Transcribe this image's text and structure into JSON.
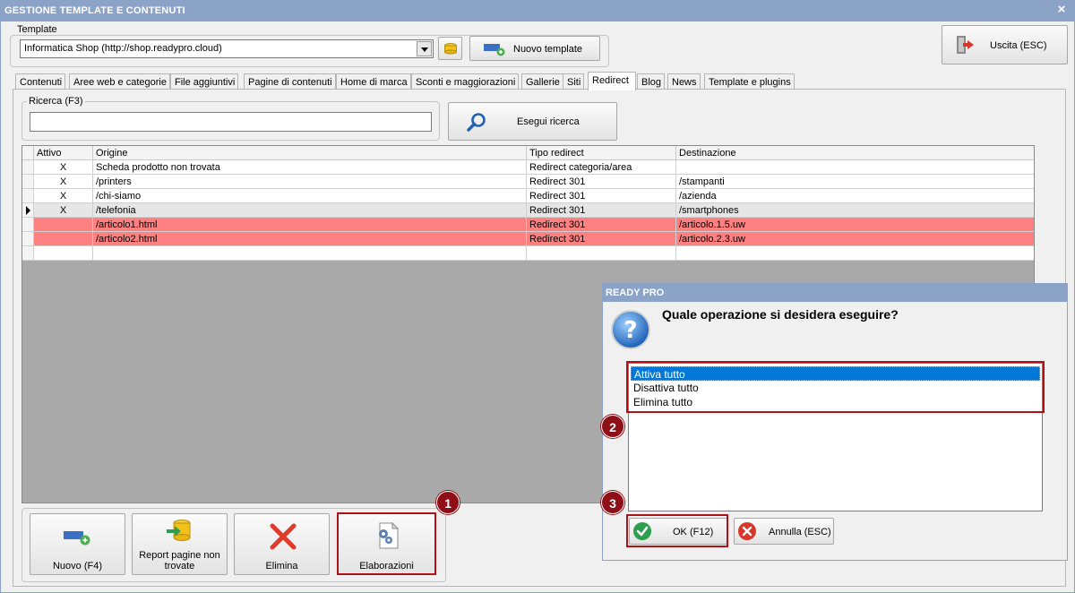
{
  "window": {
    "title": "GESTIONE TEMPLATE E CONTENUTI",
    "close_glyph": "×"
  },
  "template_group": {
    "label": "Template",
    "selected_value": "Informatica Shop (http://shop.readypro.cloud)",
    "browse_icon": "folder-icon",
    "new_template_label": "Nuovo template",
    "new_template_icon": "add-item-icon"
  },
  "exit_button": {
    "label": "Uscita (ESC)",
    "icon": "exit-door-icon"
  },
  "tabs": [
    {
      "label": "Contenuti",
      "active": false
    },
    {
      "label": "Aree web e categorie",
      "active": false
    },
    {
      "label": "File aggiuntivi",
      "active": false
    },
    {
      "label": "Pagine di contenuti",
      "active": false
    },
    {
      "label": "Home di marca",
      "active": false
    },
    {
      "label": "Sconti e maggiorazioni",
      "active": false
    },
    {
      "label": "Gallerie",
      "active": false
    },
    {
      "label": "Siti",
      "active": false
    },
    {
      "label": "Redirect",
      "active": true
    },
    {
      "label": "Blog",
      "active": false
    },
    {
      "label": "News",
      "active": false
    },
    {
      "label": "Template e plugins",
      "active": false
    }
  ],
  "search": {
    "label": "Ricerca (F3)",
    "value": "",
    "button_label": "Esegui ricerca",
    "button_icon": "magnifier-icon"
  },
  "grid": {
    "columns": [
      "Attivo",
      "Origine",
      "Tipo redirect",
      "Destinazione"
    ],
    "rows": [
      {
        "active": "X",
        "origin": "Scheda prodotto non trovata",
        "type": "Redirect categoria/area",
        "destination": "",
        "highlight": false,
        "current": false
      },
      {
        "active": "X",
        "origin": "/printers",
        "type": "Redirect 301",
        "destination": "/stampanti",
        "highlight": false,
        "current": false
      },
      {
        "active": "X",
        "origin": "/chi-siamo",
        "type": "Redirect 301",
        "destination": "/azienda",
        "highlight": false,
        "current": false
      },
      {
        "active": "X",
        "origin": "/telefonia",
        "type": "Redirect 301",
        "destination": "/smartphones",
        "highlight": false,
        "current": true
      },
      {
        "active": "",
        "origin": "/articolo1.html",
        "type": "Redirect 301",
        "destination": "/articolo.1.5.uw",
        "highlight": true,
        "current": false
      },
      {
        "active": "",
        "origin": "/articolo2.html",
        "type": "Redirect 301",
        "destination": "/articolo.2.3.uw",
        "highlight": true,
        "current": false
      },
      {
        "active": "",
        "origin": "",
        "type": "",
        "destination": "",
        "highlight": false,
        "current": false
      }
    ],
    "colors": {
      "highlight": "#ff8080",
      "current": "#e6e6e6",
      "empty_area": "#a9a9a9"
    }
  },
  "bottom_toolbar": {
    "new_label": "Nuovo (F4)",
    "report_label_1": "Report pagine non",
    "report_label_2": "trovate",
    "delete_label": "Elimina",
    "process_label": "Elaborazioni"
  },
  "dialog": {
    "title": "READY PRO",
    "question": "Quale operazione si desidera eseguire?",
    "options": [
      "Attiva tutto",
      "Disattiva tutto",
      "Elimina tutto"
    ],
    "selected_index": 0,
    "ok_label": "OK (F12)",
    "cancel_label": "Annulla (ESC)"
  },
  "callouts": [
    "1",
    "2",
    "3"
  ]
}
